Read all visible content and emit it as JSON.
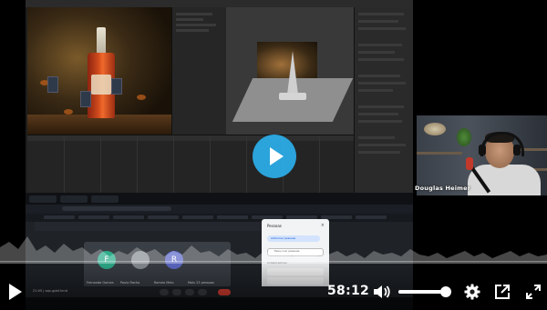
{
  "player": {
    "current_time": "58:12",
    "volume_fraction": 0.9,
    "controls": {
      "play_icon": "play-icon",
      "volume_icon": "volume-icon",
      "settings_icon": "gear-icon",
      "share_icon": "share-icon",
      "fullscreen_icon": "fullscreen-icon"
    },
    "accent_color": "#2cafeb"
  },
  "webcam": {
    "presenter_name": "Douglas Heimer"
  },
  "meet": {
    "tiles": [
      {
        "initial": "F",
        "name": "Fernanda Gomes",
        "color": "#2fae8c"
      },
      {
        "initial": "",
        "name": "Paulo Rocha",
        "color": "#3a3f46"
      },
      {
        "initial": "R",
        "name": "Romeo Melo",
        "color": "#5f6bc9"
      },
      {
        "initial": "",
        "name": "Mais 23 pessoas",
        "color": "#3a3f46"
      }
    ],
    "people_panel": {
      "title": "Pessoas",
      "add_button": "Adicionar pessoas",
      "search_placeholder": "Pesquisar pessoas",
      "section": "Colaboradores"
    },
    "toolbar_time": "21:05 | aqv-gpbf-hmd"
  }
}
